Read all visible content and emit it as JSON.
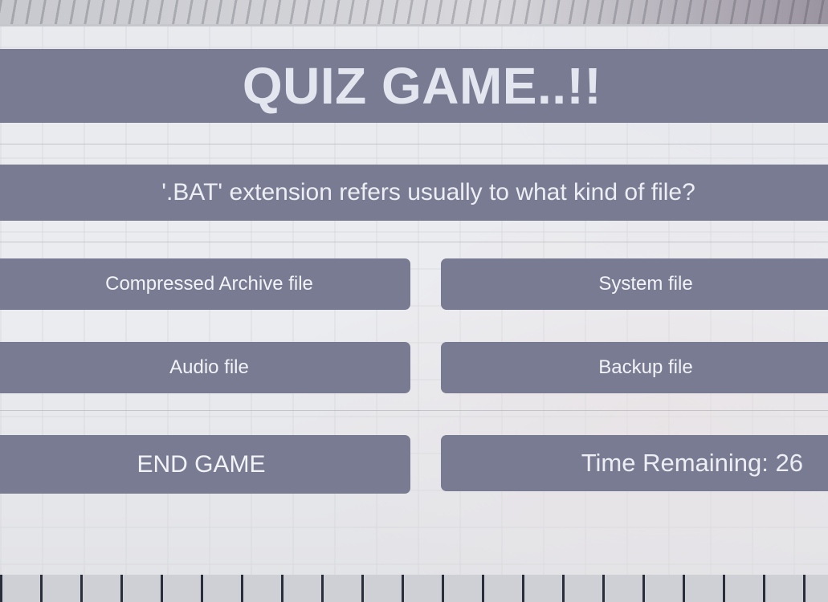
{
  "game": {
    "title": "QUIZ GAME..!!",
    "question": "'.BAT' extension refers usually to what kind of file?",
    "options": [
      "Compressed Archive file",
      "System file",
      "Audio file",
      "Backup file"
    ],
    "end_button_label": "END GAME",
    "timer_label": "Time Remaining: 26"
  },
  "colors": {
    "bar_bg": "#787b91",
    "panel_bg": "#f0f1f4",
    "text_light": "#eceef4"
  }
}
